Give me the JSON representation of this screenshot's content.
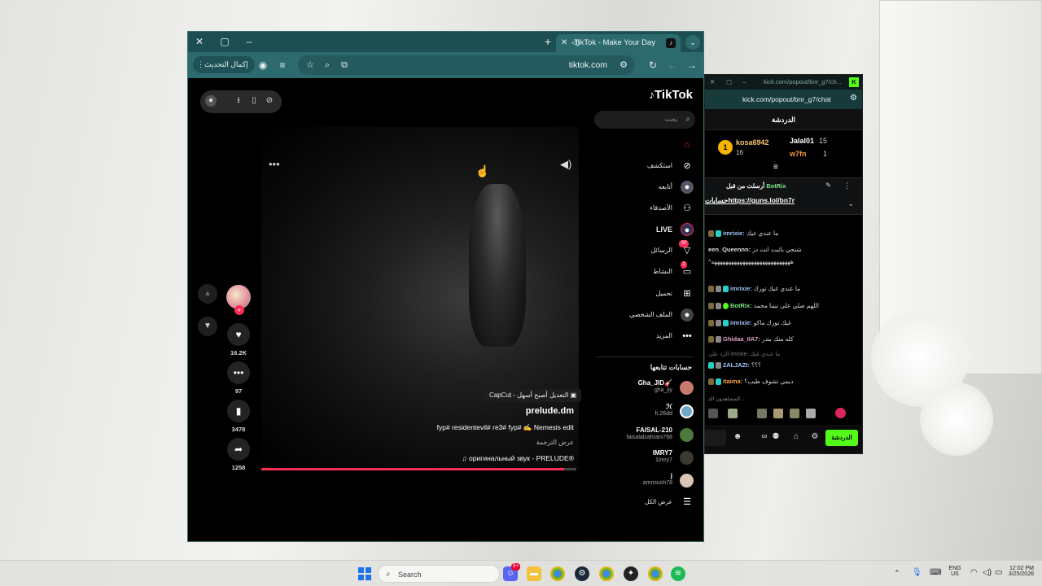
{
  "browser": {
    "tab_title": "TikTok - Make Your Day",
    "update_button": "إكمال التحديث",
    "url": "tiktok.com"
  },
  "tiktok": {
    "logo": "TikTok",
    "search_placeholder": "بحث",
    "nav": [
      {
        "label": "",
        "icon": "home-icon"
      },
      {
        "label": "استكشف",
        "icon": "compass-icon"
      },
      {
        "label": "أتابعه",
        "icon": "following-icon"
      },
      {
        "label": "الأصدقاء",
        "icon": "friends-icon"
      },
      {
        "label": "LIVE",
        "icon": "live-icon"
      },
      {
        "label": "الرسائل",
        "icon": "messages-icon",
        "badge": "30"
      },
      {
        "label": "النشاط",
        "icon": "activity-icon",
        "badge": "2"
      },
      {
        "label": "تحميل",
        "icon": "upload-icon"
      },
      {
        "label": "الملف الشخصي",
        "icon": "profile-icon"
      },
      {
        "label": "المزيد",
        "icon": "more-icon"
      }
    ],
    "following_heading": "حسابات تتابعها",
    "following": [
      {
        "name": "Gha_JID🎸",
        "handle": "gha_jiy"
      },
      {
        "name": "ℋ",
        "handle": "h.26dd"
      },
      {
        "name": "FAISAL-210",
        "handle": "faisalalzahrani768"
      },
      {
        "name": "IMRY7",
        "handle": "1imry7"
      },
      {
        "name": "j",
        "handle": "amnsush78"
      }
    ],
    "see_all": "عرض الكل",
    "video": {
      "capcut_tag": "CapCut - التعديل أصبح أسهل",
      "author": "prelude.dm",
      "description": "fyp# residentevil# re3# fyp# ✍️ Nemesis edit",
      "translate": "عرض الترجمة",
      "sound": "♫ оригинальный звук - PRELUDE®",
      "progress": 0.96
    },
    "actions": {
      "likes": "16.2K",
      "comments": "97",
      "saves": "3478",
      "shares": "1258"
    }
  },
  "kick": {
    "title_url": "kick.com/popout/bnr_g7/ch...",
    "url": "kick.com/popout/bnr_g7/chat",
    "header": "الدردشة",
    "top_gifters": [
      {
        "name": "kosa6942",
        "count": "16"
      },
      {
        "name": "Jalal01",
        "count": "15"
      },
      {
        "name": "w7fn",
        "count": "1"
      }
    ],
    "pinned": {
      "label": "أرسلت من قبل",
      "user": "BotRix",
      "text": "حساباتhttps://guns.lol/bn7r"
    },
    "messages": [
      {
        "user": "imrixie:",
        "text": "ما عندي غيك",
        "color": "#9fc7ff"
      },
      {
        "user": "een_Queennn:",
        "text": "شنجي باثبت انت دز",
        "color": "#e0e0e0"
      },
      {
        "user": "",
        "text": "^ههههههههههههههههههههههههههههه",
        "color": "#e0e0e0"
      },
      {
        "user": "imrixie:",
        "text": "ما عندي غيك تورك",
        "color": "#9fc7ff"
      },
      {
        "user": "BotRix:",
        "text": "اللهم صلي على نبينا محمد",
        "color": "#7ee787"
      },
      {
        "user": "imrixie:",
        "text": "غيك تورك ماكو",
        "color": "#9fc7ff"
      },
      {
        "user": "Ghidaa_IIA7:",
        "text": "كله منك بندر",
        "color": "#e0a0c0"
      },
      {
        "user": "",
        "text": "الرد على imrixie: ما عندي غيك",
        "color": "#777"
      },
      {
        "user": "2ALJAZI:",
        "text": "؟؟؟",
        "color": "#9fc7ff"
      },
      {
        "user": "itaima:",
        "text": "ديمي تشوف طيب؟",
        "color": "#ff9f40"
      }
    ],
    "viewers_label": "المشاهدون الذ...",
    "chat_button": "الدردشة"
  },
  "taskbar": {
    "search": "Search",
    "lang": "ENG",
    "region": "US",
    "time": "12:02 PM",
    "date": "3/25/2026",
    "discord_badge": "9+"
  }
}
